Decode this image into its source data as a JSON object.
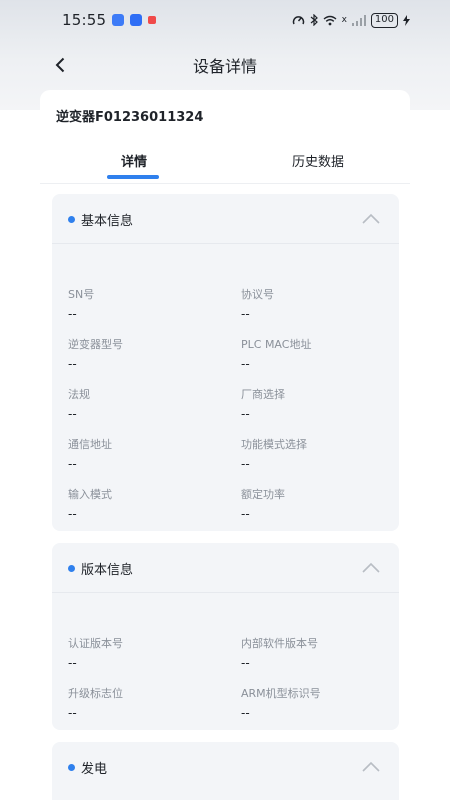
{
  "status_bar": {
    "time": "15:55",
    "signal_text": "x",
    "battery": "100"
  },
  "header": {
    "title": "设备详情"
  },
  "device": {
    "name": "逆变器F01236011324"
  },
  "tabs": [
    {
      "label": "详情"
    },
    {
      "label": "历史数据"
    }
  ],
  "sections": {
    "basic": {
      "title": "基本信息",
      "fields": [
        {
          "label": "SN号",
          "value": "--"
        },
        {
          "label": "协议号",
          "value": "--"
        },
        {
          "label": "逆变器型号",
          "value": "--"
        },
        {
          "label": "PLC MAC地址",
          "value": "--"
        },
        {
          "label": "法规",
          "value": "--"
        },
        {
          "label": "厂商选择",
          "value": "--"
        },
        {
          "label": "通信地址",
          "value": "--"
        },
        {
          "label": "功能模式选择",
          "value": "--"
        },
        {
          "label": "输入模式",
          "value": "--"
        },
        {
          "label": "额定功率",
          "value": "--"
        }
      ]
    },
    "version": {
      "title": "版本信息",
      "fields": [
        {
          "label": "认证版本号",
          "value": "--"
        },
        {
          "label": "内部软件版本号",
          "value": "--"
        },
        {
          "label": "升级标志位",
          "value": "--"
        },
        {
          "label": "ARM机型标识号",
          "value": "--"
        }
      ]
    },
    "power": {
      "title": "发电"
    }
  },
  "colors": {
    "accent": "#2f80ed",
    "card_bg": "#f3f5f8",
    "label": "#8a9099"
  }
}
